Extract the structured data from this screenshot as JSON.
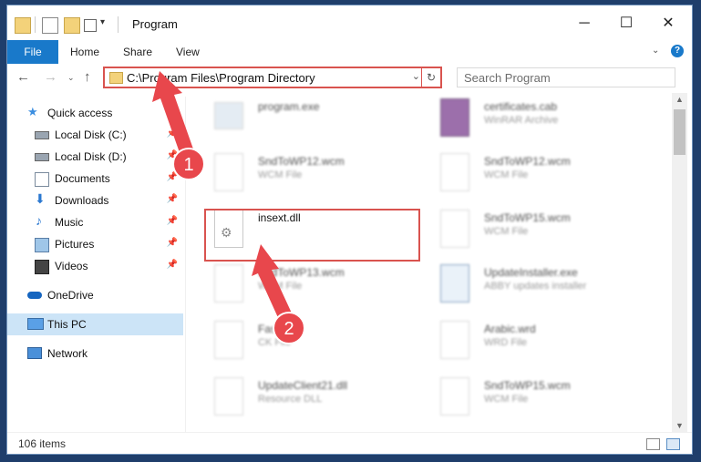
{
  "window": {
    "title": "Program"
  },
  "ribbon": {
    "tabs": [
      "File",
      "Home",
      "Share",
      "View"
    ]
  },
  "address": {
    "path": "C:\\Program Files\\Program Directory",
    "search_placeholder": "Search Program"
  },
  "sidebar": {
    "items": [
      {
        "label": "Quick access",
        "icon": "star-icon"
      },
      {
        "label": "Local Disk (C:)",
        "icon": "drive-icon"
      },
      {
        "label": "Local Disk (D:)",
        "icon": "drive-icon"
      },
      {
        "label": "Documents",
        "icon": "documents-icon"
      },
      {
        "label": "Downloads",
        "icon": "downloads-icon"
      },
      {
        "label": "Music",
        "icon": "music-icon"
      },
      {
        "label": "Pictures",
        "icon": "pictures-icon"
      },
      {
        "label": "Videos",
        "icon": "videos-icon"
      },
      {
        "label": "OneDrive",
        "icon": "cloud-icon"
      },
      {
        "label": "This PC",
        "icon": "computer-icon"
      },
      {
        "label": "Network",
        "icon": "network-icon"
      }
    ]
  },
  "files": [
    {
      "name": "program.exe",
      "type": ""
    },
    {
      "name": "certificates.cab",
      "type": "WinRAR Archive"
    },
    {
      "name": "SndToWP12.wcm",
      "type": "WCM File"
    },
    {
      "name": "SndToWP12.wcm",
      "type": "WCM File"
    },
    {
      "name": "insext.dll",
      "type": ""
    },
    {
      "name": "SndToWP15.wcm",
      "type": "WCM File"
    },
    {
      "name": "SndToWP13.wcm",
      "type": "WCM File"
    },
    {
      "name": "UpdateInstaller.exe",
      "type": "ABBY updates installer"
    },
    {
      "name": "FastDisk",
      "type": "CK File"
    },
    {
      "name": "Arabic.wrd",
      "type": "WRD File"
    },
    {
      "name": "UpdateClient21.dll",
      "type": "Resource DLL"
    },
    {
      "name": "SndToWP15.wcm",
      "type": "WCM File"
    }
  ],
  "status": {
    "count": "106 items"
  },
  "annotations": {
    "step1": "1",
    "step2": "2"
  },
  "colors": {
    "accent": "#1979ca",
    "highlight": "#d9534f",
    "selected": "#cce4f7"
  }
}
